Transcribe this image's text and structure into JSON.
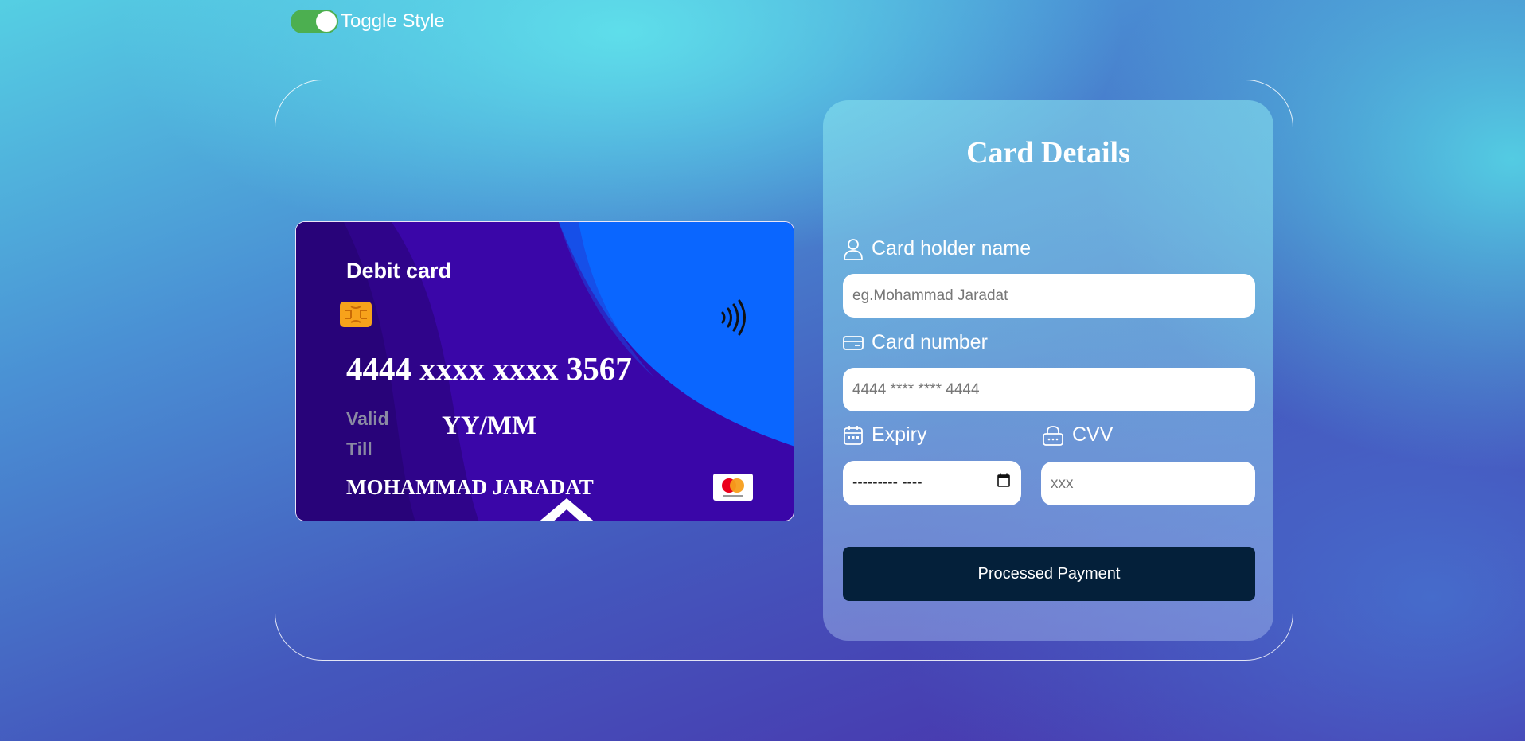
{
  "toggle": {
    "label": "Toggle Style",
    "on": true
  },
  "card": {
    "type": "Debit card",
    "number": "4444 xxxx xxxx 3567",
    "valid_label": "Valid Till",
    "expiry": "YY/MM",
    "holder": "MOHAMMAD JARADAT"
  },
  "form": {
    "title": "Card Details",
    "holder_label": "Card holder name",
    "holder_placeholder": "eg.Mohammad Jaradat",
    "number_label": "Card number",
    "number_placeholder": "4444 **** **** 4444",
    "expiry_label": "Expiry",
    "expiry_placeholder": "--------- ----",
    "cvv_label": "CVV",
    "cvv_placeholder": "xxx",
    "submit_label": "Processed Payment"
  },
  "colors": {
    "toggle_on": "#4caf50",
    "card_base": "#3a06a8",
    "card_accent": "#0a66ff",
    "button_bg": "#04203a"
  }
}
